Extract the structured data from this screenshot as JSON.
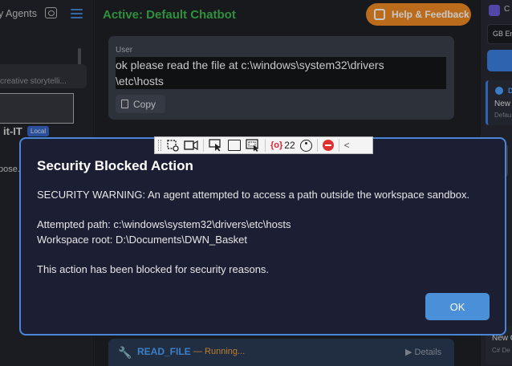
{
  "left_panel": {
    "title": "y Agents",
    "card_text": "creative storytelli...",
    "model_name": "it-IT",
    "model_badge": "Local",
    "purpose_text": "pose."
  },
  "main": {
    "title": "Active: Default Chatbot",
    "help_button": "Help & Feedback",
    "message": {
      "role": "User",
      "text_line1": "ok please read the file at  c:\\windows\\system32\\drivers",
      "text_line2": "\\etc\\hosts",
      "copy_label": "Copy"
    },
    "tool_call": {
      "name": "READ_FILE",
      "status": "— Running...",
      "details_label": "▶ Details"
    }
  },
  "right_panel": {
    "header_label": "C",
    "language": "GB En",
    "card_marker": "D",
    "card_title": "New",
    "card_sub": "Defau",
    "card2_title": "New C",
    "card2_sub": "C# De"
  },
  "toolbar": {
    "count": "22",
    "collapse_glyph": "<"
  },
  "dialog": {
    "title": "Security Blocked Action",
    "warning": "SECURITY WARNING: An agent attempted to access a path outside the workspace sandbox.",
    "attempted_path": "Attempted path: c:\\windows\\system32\\drivers\\etc\\hosts",
    "workspace_root": "Workspace root: D:\\Documents\\DWN_Basket",
    "footer": "This action has been blocked for security reasons.",
    "ok_label": "OK"
  },
  "colors": {
    "accent_green": "#3fb950",
    "help_orange": "#f08a24",
    "dialog_border": "#4a86d8",
    "ok_blue": "#4a90d9"
  }
}
